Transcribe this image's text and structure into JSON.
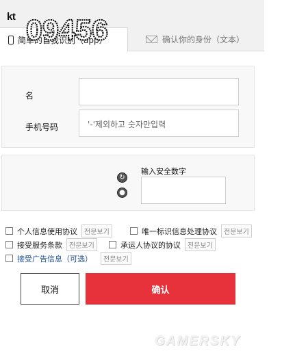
{
  "header": {
    "logo": "kt"
  },
  "tabs": [
    {
      "label": "简单的自我识别（app）",
      "icon": "phone-icon",
      "active": true
    },
    {
      "label": "确认你的身份（文本）",
      "icon": "mail-icon",
      "active": false
    }
  ],
  "form": {
    "name_label": "名",
    "name_value": "",
    "phone_label": "手机号码",
    "phone_placeholder": "'-'제외하고 숫자만입력"
  },
  "captcha": {
    "code": "09456",
    "title": "输入安全数字",
    "refresh_icon": "refresh-icon",
    "audio_icon": "speaker-icon"
  },
  "agreements": [
    {
      "label": "个人信息使用协议",
      "view": "전문보기"
    },
    {
      "label": "唯一标识信息处理协议",
      "view": "전문보기"
    },
    {
      "label": "接受服务条款",
      "view": "전문보기"
    },
    {
      "label": "承运人协议的协议",
      "view": "전문보기"
    },
    {
      "label": "接受广告信息（可选）",
      "view": "전문보기"
    }
  ],
  "buttons": {
    "cancel": "取消",
    "confirm": "确认"
  },
  "colors": {
    "confirm_bg": "#e8323b",
    "link_blue": "#1f4f96",
    "panel_bg": "#f8f8f8"
  },
  "watermark": "GAMERSKY"
}
